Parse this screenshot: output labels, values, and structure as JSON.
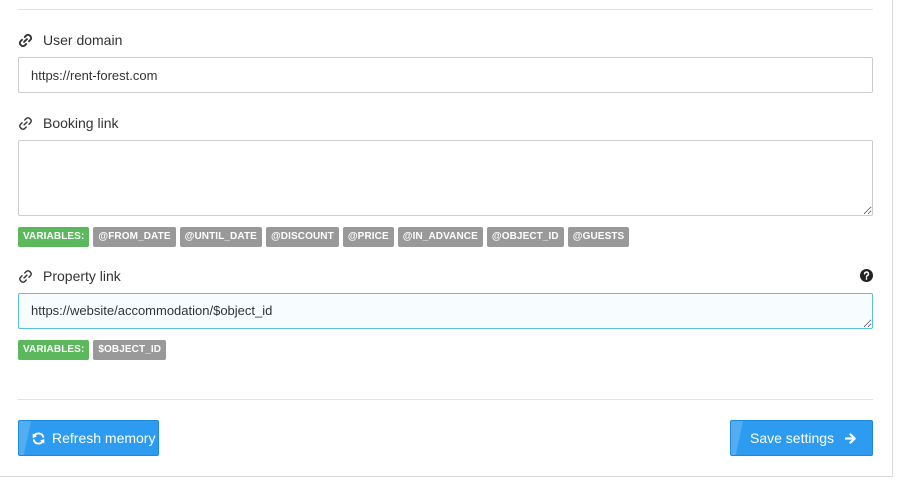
{
  "fields": {
    "user_domain": {
      "label": "User domain",
      "icon": "link-icon",
      "value": "https://rent-forest.com"
    },
    "booking_link": {
      "label": "Booking link",
      "icon": "link-icon",
      "value": "",
      "variables_label": "VARIABLES:",
      "variables": [
        "@FROM_DATE",
        "@UNTIL_DATE",
        "@DISCOUNT",
        "@PRICE",
        "@IN_ADVANCE",
        "@OBJECT_ID",
        "@GUESTS"
      ]
    },
    "property_link": {
      "label": "Property link",
      "icon": "link-icon",
      "help_icon": "question-circle-icon",
      "value": "https://website/accommodation/$object_id",
      "variables_label": "VARIABLES:",
      "variables": [
        "$OBJECT_ID"
      ]
    }
  },
  "actions": {
    "refresh_label": "Refresh memory",
    "refresh_icon": "refresh-icon",
    "save_label": "Save settings",
    "save_icon": "arrow-right-icon"
  },
  "colors": {
    "primary_button": "#2d9cf0",
    "variables_tag": "#5cb85c",
    "variable_tag": "#999999",
    "focus_border": "#5bc0de"
  }
}
